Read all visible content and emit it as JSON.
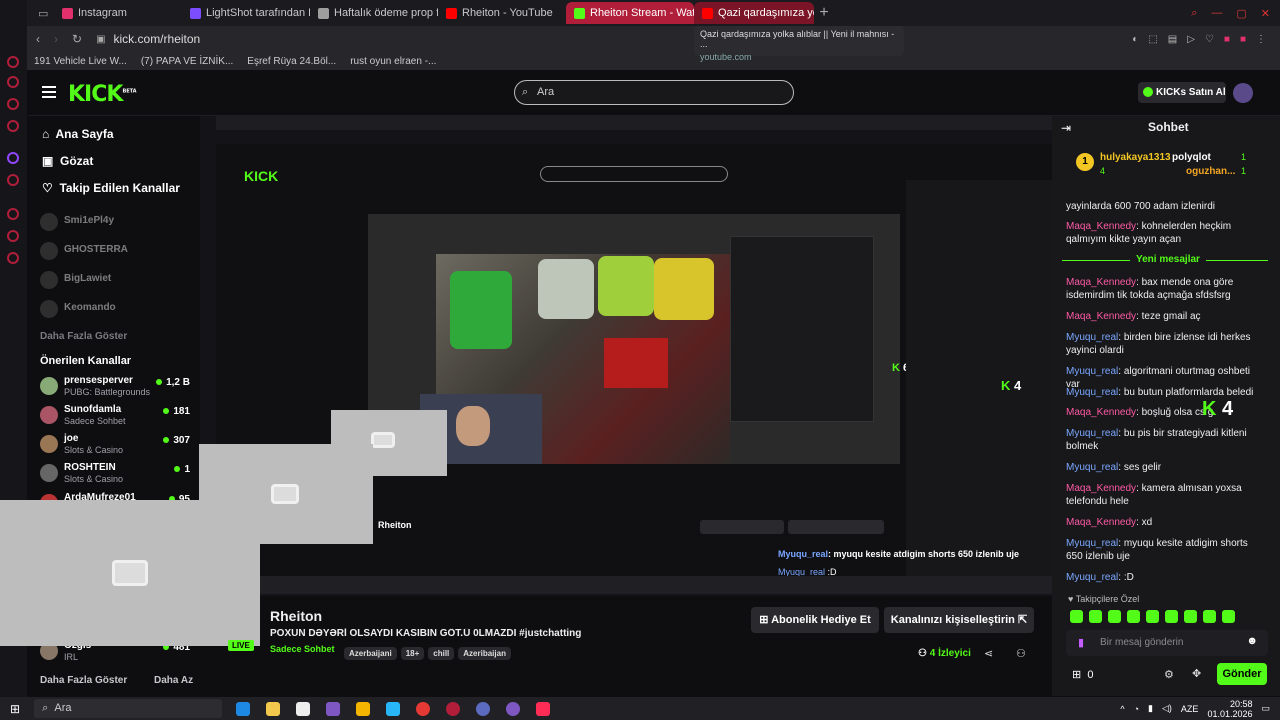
{
  "browser": {
    "tabs": [
      {
        "label": "Instagram",
        "color": "#e1306c"
      },
      {
        "label": "LightShot tarafından Ekra",
        "color": "#7c4dff"
      },
      {
        "label": "Haftalık ödeme prop firma",
        "color": "#9e9e9e"
      },
      {
        "label": "Rheiton - YouTube",
        "color": "#ff0000"
      },
      {
        "label": "Rheiton Stream - Watch L",
        "color": "#53fc18"
      },
      {
        "label": "Qazi qardaşımıza yolka",
        "color": "#ff0000"
      }
    ],
    "tooltip_title": "Qazi qardaşımıza yolka alıblar || Yeni il mahnısı - ...",
    "tooltip_url": "youtube.com",
    "url": "kick.com/rheiton",
    "bookmarks": [
      "191 Vehicle Live W...",
      "(7) PAPA VE İZNİK...",
      "Eşref Rüya 24.Böl...",
      "rust oyun elraen -..."
    ]
  },
  "kick": {
    "logo": "KICK",
    "logo_sup": "BETA",
    "search_placeholder": "Ara",
    "buy_kicks": "KICKs Satın Al",
    "nav": {
      "home": "Ana Sayfa",
      "browse": "Gözat",
      "following": "Takip Edilen Kanallar"
    },
    "followed_channels": [
      "Smi1ePl4y",
      "GHOSTERRA",
      "BigLawiet",
      "Keomando"
    ],
    "show_more": "Daha Fazla Göster",
    "recommended_title": "Önerilen Kanallar",
    "recommended": [
      {
        "name": "prensesperver",
        "sub": "PUBG: Battlegrounds",
        "viewers": "1,2 B"
      },
      {
        "name": "Sunofdamla",
        "sub": "Sadece Sohbet",
        "viewers": "181"
      },
      {
        "name": "joe",
        "sub": "Slots & Casino",
        "viewers": "307"
      },
      {
        "name": "ROSHTEIN",
        "sub": "Slots & Casino",
        "viewers": "1"
      },
      {
        "name": "ArdaMufreze01",
        "sub": "",
        "viewers": "95"
      },
      {
        "name": "Ozgis",
        "sub": "IRL",
        "viewers": "481"
      }
    ],
    "show_less": "Daha Az",
    "stream": {
      "channel": "Rheiton",
      "title": "POXUN DƏYƏRİ OLSAYDI KASIBIN GÖT.Ü 0LMAZDI #justchatting",
      "category": "Sadece Sohbet",
      "tags": [
        "Azerbaijani",
        "18+",
        "chill",
        "Azeribaijan"
      ],
      "live": "LIVE",
      "gift_sub": "Abonelik Hediye Et",
      "customize": "Kanalınızı kişiselleştirin",
      "viewers": "4 İzleyici"
    },
    "chat": {
      "title": "Sohbet",
      "gifters": [
        {
          "rank": "1",
          "name": "hulyakaya1313",
          "count": "4"
        },
        {
          "name": "polyqlot",
          "count": "1"
        },
        {
          "name": "oguzhan...",
          "count": "1"
        }
      ],
      "new_messages": "Yeni mesajlar",
      "messages": [
        {
          "user": "",
          "text": "yayinlarda 600 700 adam izlenirdi"
        },
        {
          "user": "Maqa_Kennedy",
          "text": "kohnelerden heçkim qalmıyım kikte yayın açan"
        },
        {
          "user": "Maqa_Kennedy",
          "text": "bax mende ona göre isdemirdim tik tokda açmağa sfdsfsrg"
        },
        {
          "user": "Maqa_Kennedy",
          "text": "teze gmail aç"
        },
        {
          "user": "Myuqu_real",
          "text": "birden bire izlense idi herkes yayinci olardi"
        },
        {
          "user": "Myuqu_real",
          "text": "algoritmani oturtmag oshbeti var"
        },
        {
          "user": "Myuqu_real",
          "text": "bu butun platformlarda beledi"
        },
        {
          "user": "Maqa_Kennedy",
          "text": "boşluğ olsa cs g"
        },
        {
          "user": "Myuqu_real",
          "text": "bu pis bir strategiyadi kitleni bolmek"
        },
        {
          "user": "Myuqu_real",
          "text": "ses gelir"
        },
        {
          "user": "Maqa_Kennedy",
          "text": "kamera almısan yoxsa telefondu hele"
        },
        {
          "user": "Maqa_Kennedy",
          "text": "xd"
        },
        {
          "user": "Myuqu_real",
          "text": "myuqu kesite atdigim shorts 650 izlenib uje"
        },
        {
          "user": "Myuqu_real",
          "text": ":D"
        }
      ],
      "followers_only": "Takipçilere Özel",
      "input_placeholder": "Bir mesaj gönderin",
      "points": "0",
      "send": "Gönder",
      "k_badge": "4"
    },
    "stream_overlay": {
      "k6": "6",
      "chat_line1": "myuqu kesite atdigim shorts 650 izlenib uje",
      "chat_user": "Myuqu_real",
      "chat_line2": ":D"
    }
  },
  "taskbar": {
    "search": "Ara",
    "lang": "AZE",
    "time": "20:58",
    "date": "01.01.2026"
  }
}
